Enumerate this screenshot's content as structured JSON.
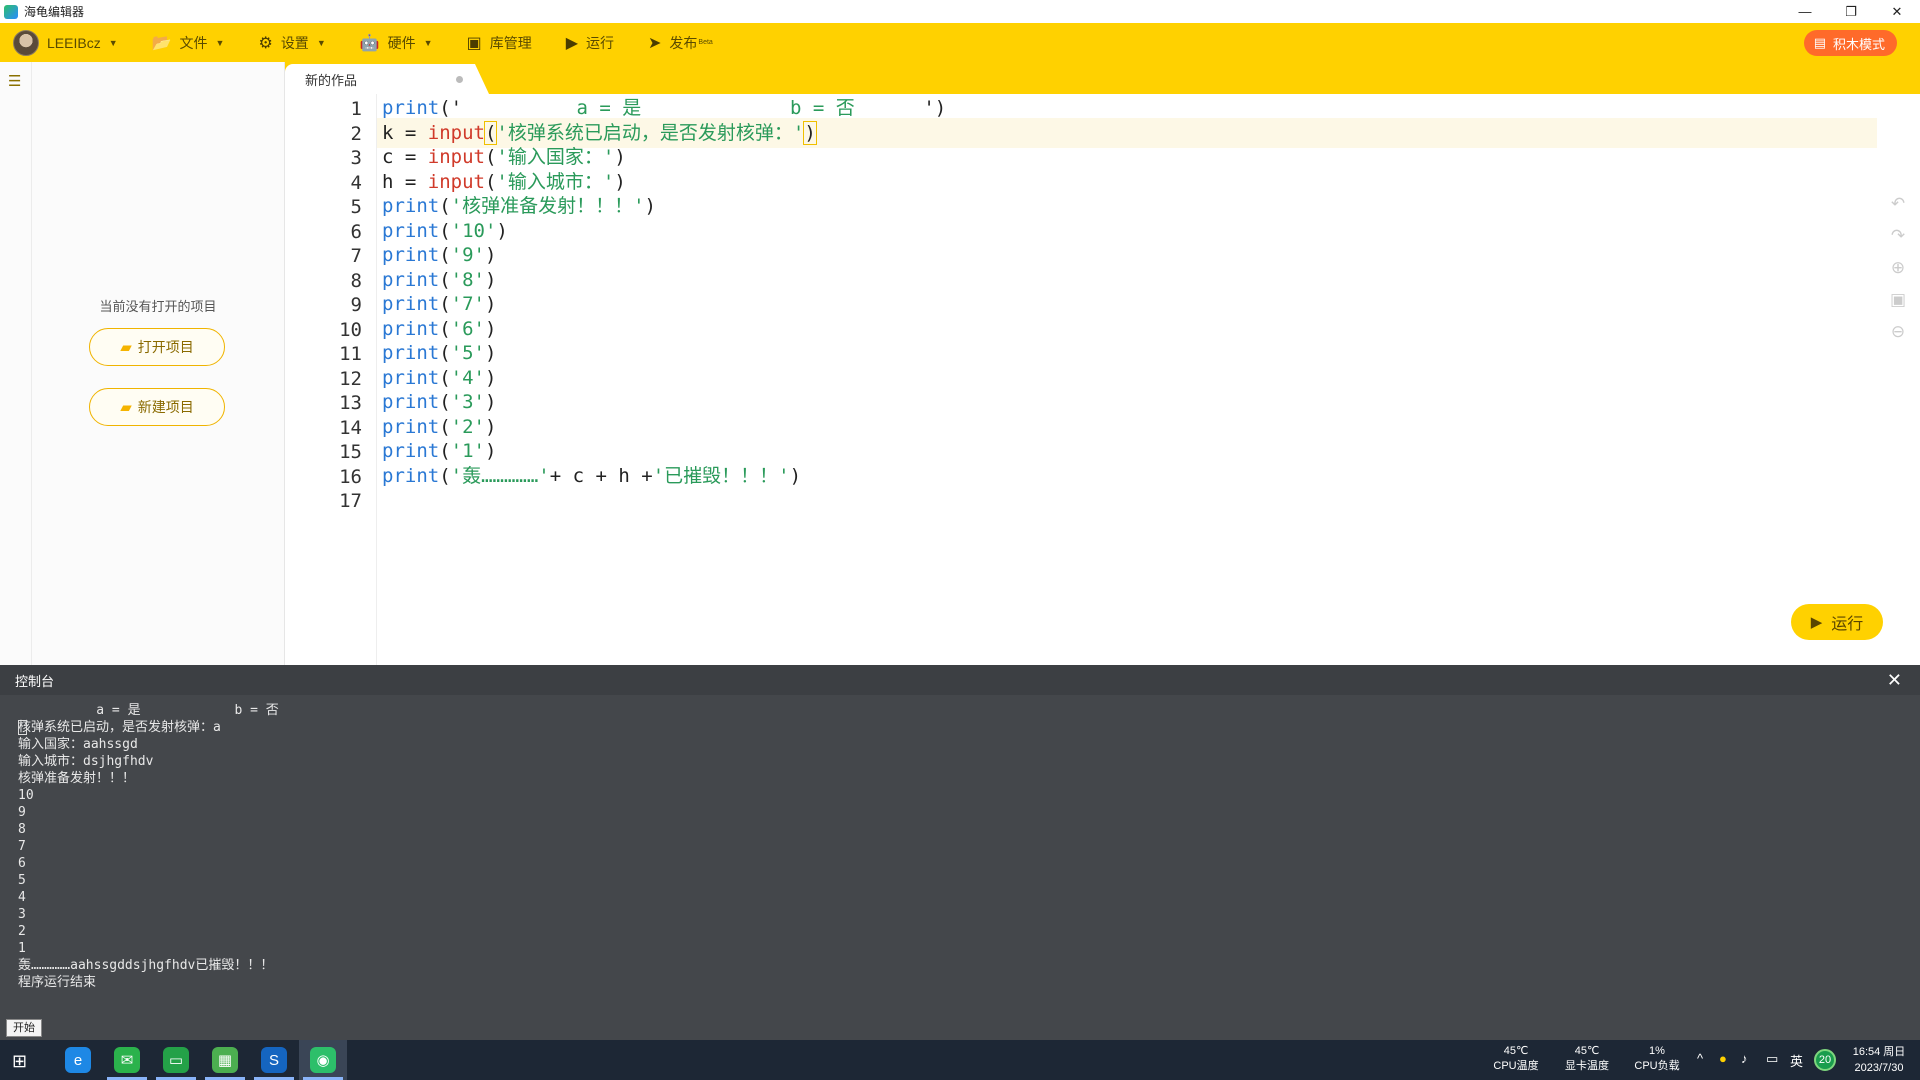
{
  "window": {
    "title": "海龟编辑器",
    "controls": [
      "—",
      "❐",
      "✕"
    ]
  },
  "toolbar": {
    "user": "LEEIBcz",
    "items": [
      {
        "label": "文件",
        "icon": "folder-icon",
        "glyph": "📂",
        "has_caret": true
      },
      {
        "label": "设置",
        "icon": "gear-icon",
        "glyph": "⚙",
        "has_caret": true
      },
      {
        "label": "硬件",
        "icon": "robot-icon",
        "glyph": "🤖",
        "has_caret": true
      },
      {
        "label": "库管理",
        "icon": "box-icon",
        "glyph": "▣",
        "has_caret": false
      },
      {
        "label": "运行",
        "icon": "play-icon",
        "glyph": "▶",
        "has_caret": false
      },
      {
        "label": "发布",
        "icon": "send-icon",
        "glyph": "➤",
        "has_caret": false,
        "badge": "Beta"
      }
    ],
    "block_mode_label": "积木模式"
  },
  "sidebar": {
    "empty_text": "当前没有打开的项目",
    "open_label": "打开项目",
    "new_label": "新建项目"
  },
  "editor": {
    "tab_title": "新的作品",
    "lines": [
      {
        "n": "1",
        "parts": [
          [
            "kw",
            "print"
          ],
          [
            "p",
            "('"
          ],
          [
            "str",
            "          a = 是             b = 否      "
          ],
          [
            "p",
            "')"
          ]
        ]
      },
      {
        "n": "2",
        "parts": [
          [
            "p",
            "k = "
          ],
          [
            "fn",
            "input"
          ],
          [
            "hl",
            "("
          ],
          [
            "str",
            "'核弹系统已启动，是否发射核弹：'"
          ],
          [
            "hl",
            ")"
          ]
        ]
      },
      {
        "n": "3",
        "parts": [
          [
            "p",
            "c = "
          ],
          [
            "fn",
            "input"
          ],
          [
            "p",
            "("
          ],
          [
            "str",
            "'输入国家：'"
          ],
          [
            "p",
            ")"
          ]
        ]
      },
      {
        "n": "4",
        "parts": [
          [
            "p",
            "h = "
          ],
          [
            "fn",
            "input"
          ],
          [
            "p",
            "("
          ],
          [
            "str",
            "'输入城市：'"
          ],
          [
            "p",
            ")"
          ]
        ]
      },
      {
        "n": "5",
        "parts": [
          [
            "kw",
            "print"
          ],
          [
            "p",
            "("
          ],
          [
            "str",
            "'核弹准备发射！！！'"
          ],
          [
            "p",
            ")"
          ]
        ]
      },
      {
        "n": "6",
        "parts": [
          [
            "kw",
            "print"
          ],
          [
            "p",
            "("
          ],
          [
            "str",
            "'10'"
          ],
          [
            "p",
            ")"
          ]
        ]
      },
      {
        "n": "7",
        "parts": [
          [
            "kw",
            "print"
          ],
          [
            "p",
            "("
          ],
          [
            "str",
            "'9'"
          ],
          [
            "p",
            ")"
          ]
        ]
      },
      {
        "n": "8",
        "parts": [
          [
            "kw",
            "print"
          ],
          [
            "p",
            "("
          ],
          [
            "str",
            "'8'"
          ],
          [
            "p",
            ")"
          ]
        ]
      },
      {
        "n": "9",
        "parts": [
          [
            "kw",
            "print"
          ],
          [
            "p",
            "("
          ],
          [
            "str",
            "'7'"
          ],
          [
            "p",
            ")"
          ]
        ]
      },
      {
        "n": "10",
        "parts": [
          [
            "kw",
            "print"
          ],
          [
            "p",
            "("
          ],
          [
            "str",
            "'6'"
          ],
          [
            "p",
            ")"
          ]
        ]
      },
      {
        "n": "11",
        "parts": [
          [
            "kw",
            "print"
          ],
          [
            "p",
            "("
          ],
          [
            "str",
            "'5'"
          ],
          [
            "p",
            ")"
          ]
        ]
      },
      {
        "n": "12",
        "parts": [
          [
            "kw",
            "print"
          ],
          [
            "p",
            "("
          ],
          [
            "str",
            "'4'"
          ],
          [
            "p",
            ")"
          ]
        ]
      },
      {
        "n": "13",
        "parts": [
          [
            "kw",
            "print"
          ],
          [
            "p",
            "("
          ],
          [
            "str",
            "'3'"
          ],
          [
            "p",
            ")"
          ]
        ]
      },
      {
        "n": "14",
        "parts": [
          [
            "kw",
            "print"
          ],
          [
            "p",
            "("
          ],
          [
            "str",
            "'2'"
          ],
          [
            "p",
            ")"
          ]
        ]
      },
      {
        "n": "15",
        "parts": [
          [
            "kw",
            "print"
          ],
          [
            "p",
            "("
          ],
          [
            "str",
            "'1'"
          ],
          [
            "p",
            ")"
          ]
        ]
      },
      {
        "n": "16",
        "parts": [
          [
            "kw",
            "print"
          ],
          [
            "p",
            "("
          ],
          [
            "str",
            "'轰……………'"
          ],
          [
            "p",
            "+ c + h +"
          ],
          [
            "str",
            "'已摧毁！！！'"
          ],
          [
            "p",
            ")"
          ]
        ]
      },
      {
        "n": "17",
        "parts": []
      }
    ],
    "active_line": 2,
    "run_label": "运行"
  },
  "console": {
    "title": "控制台",
    "lines": [
      "          a = 是            b = 否",
      "核弹系统已启动，是否发射核弹：a",
      "输入国家：aahssgd",
      "输入城市：dsjhgfhdv",
      "核弹准备发射！！！",
      "10",
      "9",
      "8",
      "7",
      "6",
      "5",
      "4",
      "3",
      "2",
      "1",
      "轰……………aahssgddsjhgfhdv已摧毁！！！",
      "程序运行结束"
    ]
  },
  "start_tooltip": "开始",
  "taskbar": {
    "apps": [
      {
        "name": "ie-icon",
        "glyph": "e",
        "color": "#1e88e5"
      },
      {
        "name": "wechat-icon",
        "glyph": "✉",
        "color": "#2bb24c"
      },
      {
        "name": "chat-app-icon",
        "glyph": "▭",
        "color": "#24a148"
      },
      {
        "name": "store-app-icon",
        "glyph": "▦",
        "color": "#4caf50"
      },
      {
        "name": "sogou-icon",
        "glyph": "S",
        "color": "#1565c0"
      },
      {
        "name": "turtle-editor-icon",
        "glyph": "◉",
        "color": "#2dbf6a"
      }
    ],
    "stats": [
      {
        "value": "45℃",
        "label": "CPU温度"
      },
      {
        "value": "45℃",
        "label": "显卡温度"
      },
      {
        "value": "1%",
        "label": "CPU负载"
      }
    ],
    "ime": "英",
    "badge": "20",
    "time": "16:54 周日",
    "date": "2023/7/30"
  }
}
